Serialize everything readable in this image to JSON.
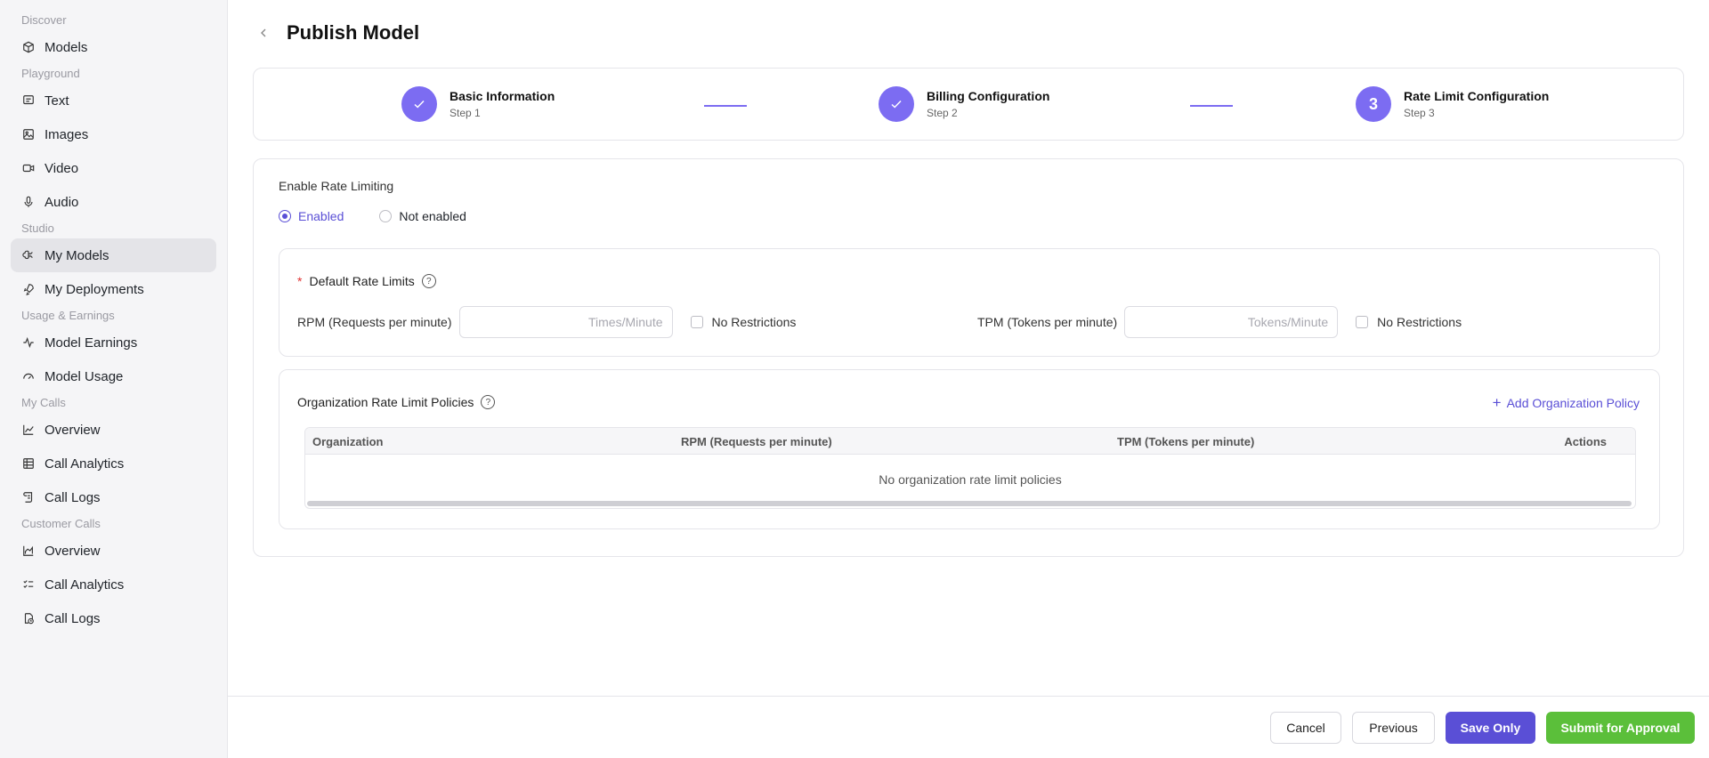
{
  "sidebar": {
    "sections": [
      {
        "label": "Discover",
        "items": [
          {
            "label": "Models",
            "icon": "cube-icon"
          }
        ]
      },
      {
        "label": "Playground",
        "items": [
          {
            "label": "Text",
            "icon": "chat-icon"
          },
          {
            "label": "Images",
            "icon": "image-icon"
          },
          {
            "label": "Video",
            "icon": "video-icon"
          },
          {
            "label": "Audio",
            "icon": "mic-icon"
          }
        ]
      },
      {
        "label": "Studio",
        "items": [
          {
            "label": "My Models",
            "icon": "brain-icon",
            "active": true
          },
          {
            "label": "My Deployments",
            "icon": "rocket-icon"
          }
        ]
      },
      {
        "label": "Usage & Earnings",
        "items": [
          {
            "label": "Model Earnings",
            "icon": "pulse-icon"
          },
          {
            "label": "Model Usage",
            "icon": "gauge-icon"
          }
        ]
      },
      {
        "label": "My Calls",
        "items": [
          {
            "label": "Overview",
            "icon": "line-chart-icon"
          },
          {
            "label": "Call Analytics",
            "icon": "table-icon"
          },
          {
            "label": "Call Logs",
            "icon": "scroll-icon"
          }
        ]
      },
      {
        "label": "Customer Calls",
        "items": [
          {
            "label": "Overview",
            "icon": "area-chart-icon"
          },
          {
            "label": "Call Analytics",
            "icon": "list-check-icon"
          },
          {
            "label": "Call Logs",
            "icon": "clock-doc-icon"
          }
        ]
      }
    ]
  },
  "header": {
    "title": "Publish Model"
  },
  "steps": [
    {
      "title": "Basic Information",
      "sub": "Step 1",
      "state": "done"
    },
    {
      "title": "Billing Configuration",
      "sub": "Step 2",
      "state": "done"
    },
    {
      "title": "Rate Limit Configuration",
      "sub": "Step 3",
      "state": "current",
      "number": "3"
    }
  ],
  "form": {
    "enable_label": "Enable Rate Limiting",
    "radio_enabled": "Enabled",
    "radio_disabled": "Not enabled",
    "default_title": "Default Rate Limits",
    "rpm_label": "RPM (Requests per minute)",
    "rpm_placeholder": "Times/Minute",
    "tpm_label": "TPM (Tokens per minute)",
    "tpm_placeholder": "Tokens/Minute",
    "no_restrictions": "No Restrictions",
    "org_title": "Organization Rate Limit Policies",
    "add_policy": "Add Organization Policy",
    "table": {
      "columns": [
        "Organization",
        "RPM (Requests per minute)",
        "TPM (Tokens per minute)",
        "Actions"
      ],
      "empty": "No organization rate limit policies"
    }
  },
  "footer": {
    "cancel": "Cancel",
    "previous": "Previous",
    "save": "Save Only",
    "submit": "Submit for Approval"
  },
  "colors": {
    "accent": "#5a4fd6",
    "step": "#7c6cf2",
    "success": "#5bbf3a"
  }
}
